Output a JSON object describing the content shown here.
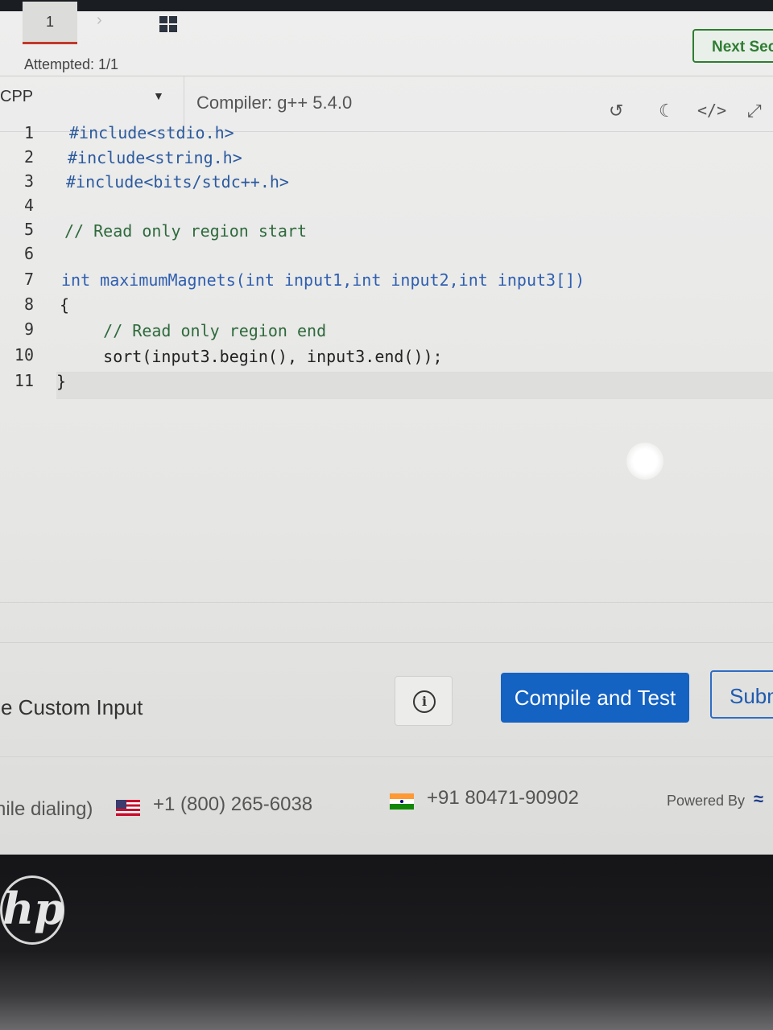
{
  "header": {
    "question_tab_number": "1",
    "attempted": "Attempted: 1/1",
    "next_button": "Next Sec"
  },
  "toolbar": {
    "language": "CPP",
    "compiler": "Compiler: g++ 5.4.0",
    "icons": [
      "history-icon",
      "theme-moon-icon",
      "code-icon",
      "expand-icon"
    ]
  },
  "editor": {
    "line_numbers": [
      "1",
      "2",
      "3",
      "4",
      "5",
      "6",
      "7",
      "8",
      "9",
      "10",
      "11"
    ],
    "lines": [
      "#include<stdio.h>",
      "#include<string.h>",
      "#include<bits/stdc++.h>",
      "",
      "// Read only region start",
      "",
      "int maximumMagnets(int input1,int input2,int input3[])",
      "{",
      "    // Read only region end",
      "    sort(input3.begin(), input3.end());",
      "}"
    ]
  },
  "actions": {
    "custom_input_label": "se Custom Input",
    "compile_button": "Compile and Test",
    "submit_button": "Subm"
  },
  "footer": {
    "dialing_note": "hile dialing)",
    "phone_us": "+1 (800) 265-6038",
    "phone_in": "+91 80471-90902",
    "powered_by": "Powered By"
  },
  "device": {
    "logo": "hp"
  }
}
